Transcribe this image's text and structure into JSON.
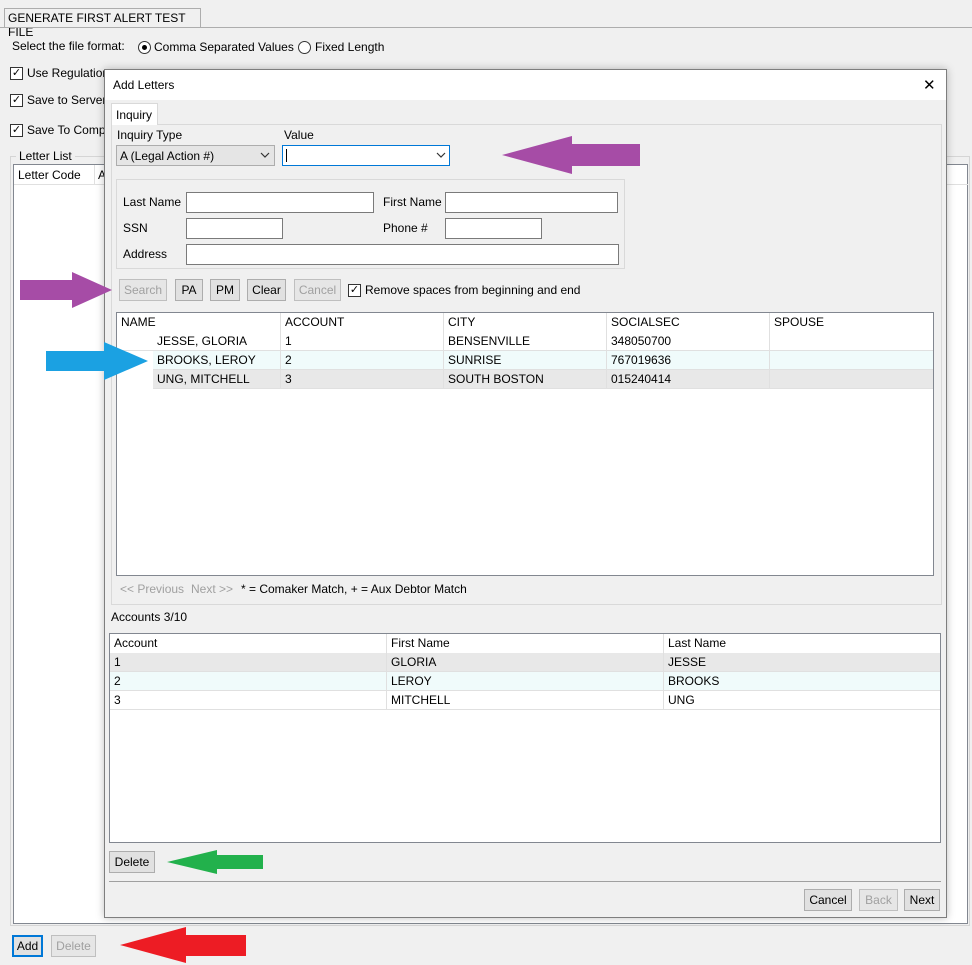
{
  "background": {
    "title_tab": "GENERATE FIRST ALERT TEST FILE",
    "file_format_label": "Select the file format:",
    "format_options": [
      "Comma Separated Values",
      "Fixed Length"
    ],
    "checkboxes": [
      "Use Regulation",
      "Save to Server",
      "Save To Compu"
    ],
    "letter_list_label": "Letter List",
    "letter_list_columns": [
      "Letter Code",
      "A"
    ],
    "add_button": "Add",
    "delete_button": "Delete"
  },
  "dialog": {
    "title": "Add Letters",
    "close_glyph": "✕",
    "tab_label": "Inquiry",
    "inquiry_type_label": "Inquiry Type",
    "inquiry_type_value": "A (Legal Action #)",
    "value_label": "Value",
    "value_text": "",
    "last_name_label": "Last Name",
    "first_name_label": "First Name",
    "ssn_label": "SSN",
    "phone_label": "Phone #",
    "address_label": "Address",
    "buttons": {
      "search": "Search",
      "pa": "PA",
      "pm": "PM",
      "clear": "Clear",
      "cancel": "Cancel"
    },
    "trim_checkbox_label": "Remove spaces from beginning and end",
    "results": {
      "columns": [
        "NAME",
        "ACCOUNT",
        "CITY",
        "SOCIALSEC",
        "SPOUSE"
      ],
      "rows": [
        [
          "JESSE, GLORIA",
          "1",
          "BENSENVILLE",
          "348050700",
          ""
        ],
        [
          "BROOKS, LEROY",
          "2",
          "SUNRISE",
          "767019636",
          ""
        ],
        [
          "UNG, MITCHELL",
          "3",
          "SOUTH BOSTON",
          "015240414",
          ""
        ]
      ]
    },
    "pager": {
      "previous": "<< Previous",
      "next": "Next >>",
      "legend": "* = Comaker Match, + = Aux Debtor Match"
    },
    "accounts_label": "Accounts 3/10",
    "accounts": {
      "columns": [
        "Account",
        "First Name",
        "Last Name"
      ],
      "rows": [
        [
          "1",
          "GLORIA",
          "JESSE"
        ],
        [
          "2",
          "LEROY",
          "BROOKS"
        ],
        [
          "3",
          "MITCHELL",
          "UNG"
        ]
      ]
    },
    "delete_button": "Delete",
    "footer": {
      "cancel": "Cancel",
      "back": "Back",
      "next": "Next"
    }
  },
  "colors": {
    "arrow_purple": "#a64ca6",
    "arrow_blue": "#1ba1e2",
    "arrow_green": "#22b14c",
    "arrow_red": "#ed1c24",
    "focus_blue": "#0078d7"
  }
}
